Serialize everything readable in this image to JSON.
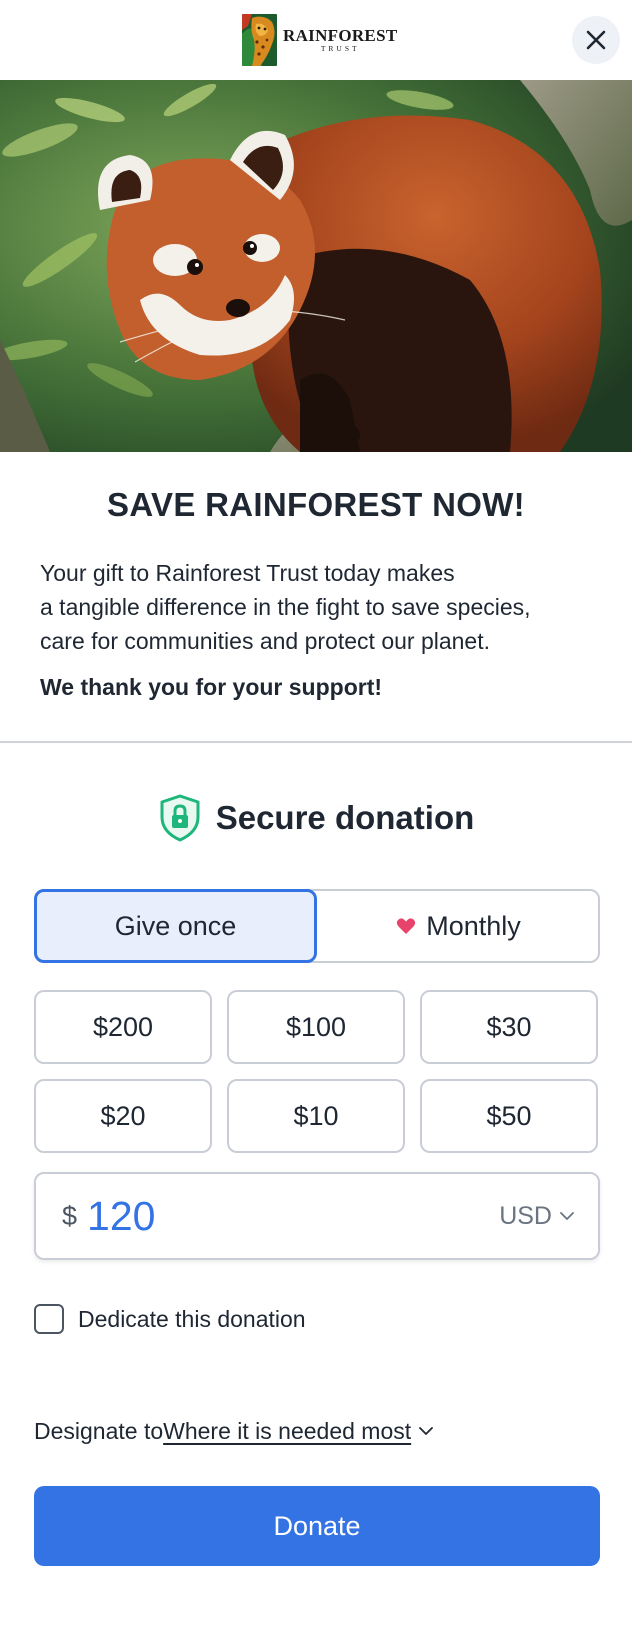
{
  "header": {
    "logo": {
      "line1": "RAINFOREST",
      "line2": "TRUST"
    },
    "close_icon": "close-icon"
  },
  "hero": {
    "alt": "Red panda on a tree branch"
  },
  "intro": {
    "title": "SAVE RAINFOREST NOW!",
    "description": "Your gift to Rainforest Trust today makes\na tangible difference in the fight to save species,\ncare for communities and protect our planet.",
    "thanks": "We thank you for your support!"
  },
  "secure": {
    "label": "Secure donation",
    "icon": "shield-lock-icon"
  },
  "frequency": {
    "once_label": "Give once",
    "monthly_label": "Monthly",
    "selected": "once"
  },
  "amounts": [
    "$200",
    "$100",
    "$30",
    "$20",
    "$10",
    "$50"
  ],
  "custom_amount": {
    "symbol": "$",
    "value": "120",
    "currency": "USD"
  },
  "dedicate": {
    "label": "Dedicate this donation",
    "checked": false
  },
  "designate": {
    "prefix": "Designate to",
    "value": "Where it is needed most"
  },
  "donate_label": "Donate",
  "colors": {
    "accent": "#3473e3",
    "heart": "#e8436b",
    "shield": "#1eb67a"
  }
}
